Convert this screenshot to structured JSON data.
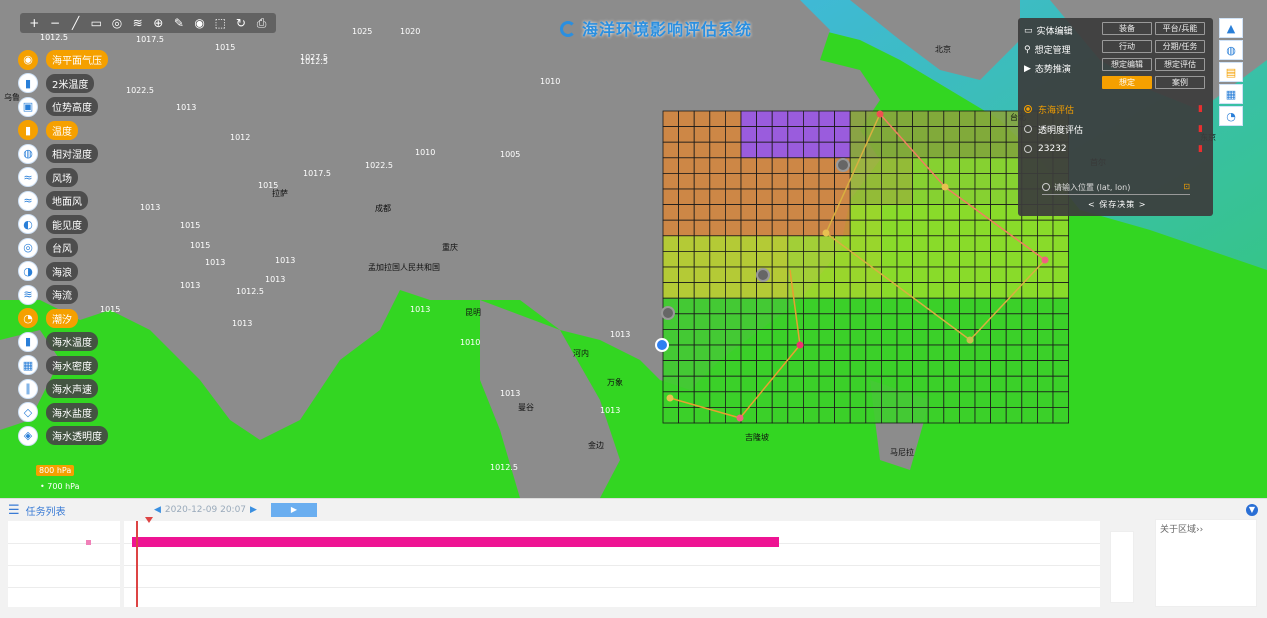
{
  "app": {
    "title": "海洋环境影响评估系统"
  },
  "toolbar": [
    {
      "name": "zoom-in-icon",
      "glyph": "+"
    },
    {
      "name": "zoom-out-icon",
      "glyph": "−"
    },
    {
      "name": "ruler-icon",
      "glyph": "╱"
    },
    {
      "name": "area-measure-icon",
      "glyph": "▭"
    },
    {
      "name": "locate-icon",
      "glyph": "◎"
    },
    {
      "name": "layers-icon",
      "glyph": "≋"
    },
    {
      "name": "globe-icon",
      "glyph": "⊕"
    },
    {
      "name": "edit-icon",
      "glyph": "✎"
    },
    {
      "name": "record-icon",
      "glyph": "◉"
    },
    {
      "name": "select-icon",
      "glyph": "⬚"
    },
    {
      "name": "refresh-icon",
      "glyph": "↻"
    },
    {
      "name": "print-icon",
      "glyph": "⎙"
    }
  ],
  "layers": [
    {
      "label": "海平面气压",
      "icon": "◉",
      "on": true
    },
    {
      "label": "2米温度",
      "icon": "▮",
      "on": false
    },
    {
      "label": "位势高度",
      "icon": "▣",
      "on": false
    },
    {
      "label": "温度",
      "icon": "▮",
      "on": true
    },
    {
      "label": "相对湿度",
      "icon": "◍",
      "on": false
    },
    {
      "label": "风场",
      "icon": "≈",
      "on": false
    },
    {
      "label": "地面风",
      "icon": "≈",
      "on": false
    },
    {
      "label": "能见度",
      "icon": "◐",
      "on": false
    },
    {
      "label": "台风",
      "icon": "◎",
      "on": false
    },
    {
      "label": "海浪",
      "icon": "◑",
      "on": false
    },
    {
      "label": "海流",
      "icon": "≋",
      "on": false
    },
    {
      "label": "潮汐",
      "icon": "◔",
      "on": true
    },
    {
      "label": "海水温度",
      "icon": "▮",
      "on": false
    },
    {
      "label": "海水密度",
      "icon": "▦",
      "on": false
    },
    {
      "label": "海水声速",
      "icon": "∥",
      "on": false
    },
    {
      "label": "海水盐度",
      "icon": "◇",
      "on": false
    },
    {
      "label": "海水透明度",
      "icon": "◈",
      "on": false
    }
  ],
  "legend": {
    "pressure_label": "800 hPa",
    "pressure_value": "• 700 hPa"
  },
  "panel": {
    "rows": [
      {
        "label": "实体编辑",
        "icon": "▭",
        "buttons": [
          "装备",
          "平台/兵能",
          "行动",
          "分期/任务"
        ]
      },
      {
        "label": "想定管理",
        "icon": "⚲",
        "buttons": [
          "想定编辑",
          "想定评估"
        ]
      },
      {
        "label": "态势推演",
        "icon": "▶",
        "buttons": [
          "想定",
          "案例"
        ]
      }
    ],
    "items": [
      {
        "name": "东海评估",
        "selected": true
      },
      {
        "name": "透明度评估",
        "selected": false
      },
      {
        "name": "23232",
        "selected": false
      }
    ],
    "coord_placeholder": "请输入位置 (lat, lon)",
    "pager": "< 保存决策 >"
  },
  "right_tools": [
    {
      "name": "north-arrow-icon",
      "glyph": "▲"
    },
    {
      "name": "globe-view-icon",
      "glyph": "◍"
    },
    {
      "name": "clipboard-icon",
      "glyph": "▤"
    },
    {
      "name": "table-icon",
      "glyph": "▦"
    },
    {
      "name": "pie-chart-icon",
      "glyph": "◔"
    }
  ],
  "bottom": {
    "task_list_label": "任务列表",
    "datetime": "2020-12-09 20:07",
    "play_button": "▶",
    "info_label": "关于区域››",
    "progress": 0.67
  },
  "map_labels": {
    "pressure": [
      "1012.5",
      "1017.5",
      "1015",
      "1012.5",
      "1020",
      "1010",
      "1025",
      "1022.5",
      "1027.5",
      "1013",
      "1012",
      "1015",
      "1017.5",
      "1022.5",
      "1010",
      "1005",
      "1013",
      "1015",
      "1015",
      "1013",
      "1013",
      "1013",
      "1012.5",
      "1015",
      "1013",
      "1013",
      "1013",
      "1010",
      "1013",
      "1013",
      "1012.5",
      "1013"
    ],
    "places": [
      "乌鲁",
      "北京",
      "拉萨",
      "成都",
      "重庆",
      "昆明",
      "孟加拉国人民共和国",
      "河内",
      "万象",
      "曼谷",
      "金边",
      "吉隆坡",
      "马尼拉",
      "台北",
      "首尔",
      "东京"
    ]
  }
}
